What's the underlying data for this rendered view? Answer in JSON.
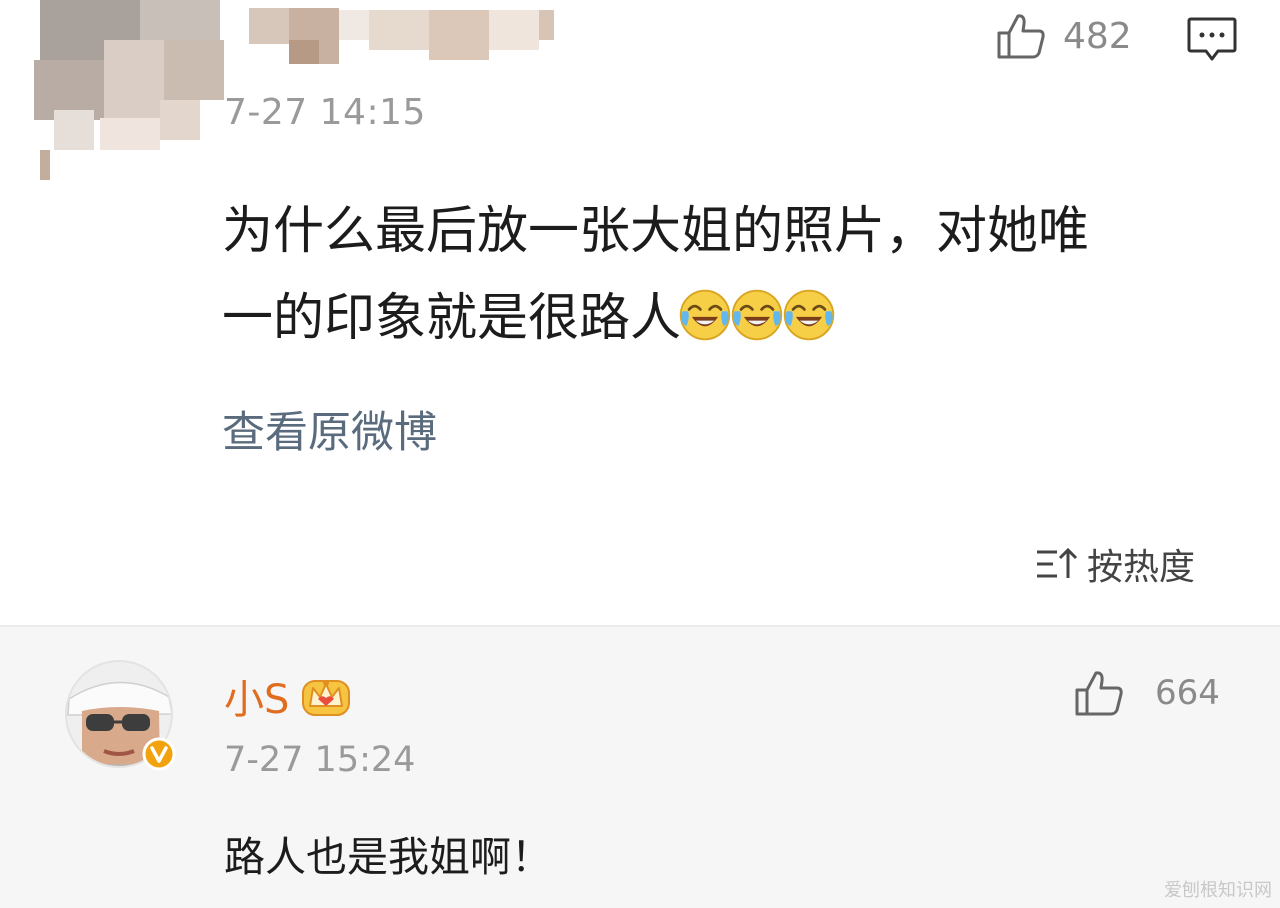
{
  "post": {
    "timestamp": "7-27 14:15",
    "likes": "482",
    "text_line1": "为什么最后放一张大姐的照片，对她唯",
    "text_line2": "一的印象就是很路人",
    "emoji_count": 3,
    "emoji_icon": "laugh-cry-emoji",
    "view_original_label": "查看原微博"
  },
  "sort": {
    "label": "按热度",
    "icon": "sort-icon"
  },
  "reply": {
    "username": "小S",
    "badge_icon": "crown-badge-icon",
    "verified_icon": "verified-v-icon",
    "timestamp": "7-27 15:24",
    "likes": "664",
    "text": "路人也是我姐啊！"
  },
  "watermark": "爱刨根知识网",
  "colors": {
    "username": "#e06d1f",
    "link": "#5a6b7e",
    "timestamp": "#9a9a9a",
    "reply_background": "#f6f6f6",
    "verified": "#f2a20c"
  }
}
